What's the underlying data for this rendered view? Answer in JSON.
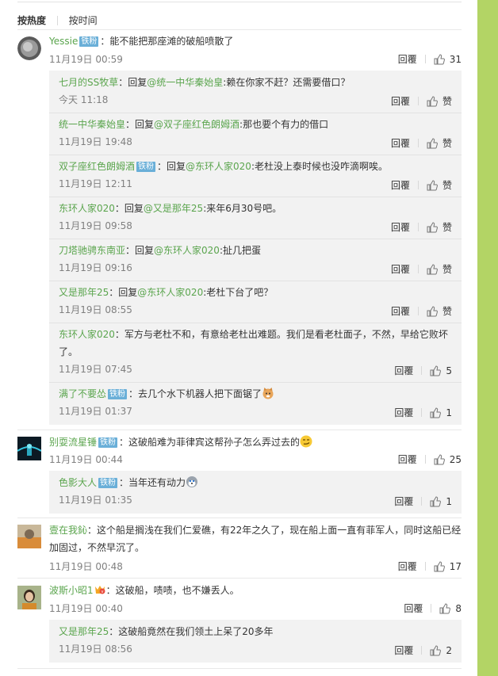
{
  "sort": {
    "hot": "按热度",
    "time": "按时间"
  },
  "reply_label": "回覆",
  "like_icon": "thumb-up-icon",
  "colors": {
    "name_link": "#5ba54e",
    "badge": "#6aafd8",
    "reply_bg": "#f2f2f2",
    "side_strip": "#b3d465"
  },
  "comments": [
    {
      "name": "Yessie",
      "badge": "铁粉",
      "text": "：能不能把那座滩的破船喷散了",
      "time": "11月19日 00:59",
      "likes": "31",
      "replies": [
        {
          "name": "七月的SS牧草",
          "pre": "：回复",
          "mention": "@统一中华秦始皇",
          "text": ":赖在你家不赶？还需要借口？",
          "time": "今天 11:18",
          "likes": "赞"
        },
        {
          "name": "统一中华秦始皇",
          "pre": "：回复",
          "mention": "@双子座红色朗姆酒",
          "text": ":那也要个有力的借口",
          "time": "11月19日 19:48",
          "likes": "赞"
        },
        {
          "name": "双子座红色朗姆酒",
          "badge": "铁粉",
          "pre": "：回复",
          "mention": "@东环人家020",
          "text": ":老杜没上泰时候也没咋滴啊唉。",
          "time": "11月19日 12:11",
          "likes": "赞"
        },
        {
          "name": "东环人家020",
          "pre": "：回复",
          "mention": "@又是那年25",
          "text": ":来年6月30号吧。",
          "time": "11月19日 09:58",
          "likes": "赞"
        },
        {
          "name": "刀塔驰骋东南亚",
          "pre": "：回复",
          "mention": "@东环人家020",
          "text": ":扯几把蛋",
          "time": "11月19日 09:16",
          "likes": "赞"
        },
        {
          "name": "又是那年25",
          "pre": "：回复",
          "mention": "@东环人家020",
          "text": ":老杜下台了吧？",
          "time": "11月19日 08:55",
          "likes": "赞"
        },
        {
          "name": "东环人家020",
          "pre": "",
          "mention": "",
          "text": "：军方与老杜不和，有意给老杜出难题。我们是看老杜面子，不然，早给它败坏了。",
          "time": "11月19日 07:45",
          "likes": "5"
        },
        {
          "name": "满了不要怂",
          "badge": "铁粉",
          "pre": "",
          "mention": "",
          "text": "：去几个水下机器人把下面锯了",
          "emoji": "cat-emoji",
          "time": "11月19日 01:37",
          "likes": "1"
        }
      ]
    },
    {
      "name": "别耍流星锤",
      "badge": "铁粉",
      "text": "：这破船难为菲律宾这帮孙子怎么弄过去的",
      "emoji": "smirk-emoji",
      "time": "11月19日 00:44",
      "likes": "25",
      "replies": [
        {
          "name": "色影大人",
          "badge": "铁粉",
          "pre": "",
          "mention": "",
          "text": "：当年还有动力",
          "emoji": "husky-emoji",
          "time": "11月19日 01:35",
          "likes": "1"
        }
      ]
    },
    {
      "name": "壹在我鈊",
      "text": "：这个船是搁浅在我们仁爱礁，有22年之久了，现在船上面一直有菲军人，同时这船已经加固过，不然早沉了。",
      "time": "11月19日 00:48",
      "likes": "17",
      "replies": []
    },
    {
      "name": "波斯小昭1",
      "vip": "VIP-badge-icon",
      "text": "：这破船，啧啧，也不嫌丢人。",
      "time": "11月19日 00:40",
      "likes": "8",
      "replies": [
        {
          "name": "又是那年25",
          "pre": "",
          "mention": "",
          "text": "：这破船竟然在我们领土上呆了20多年",
          "time": "11月19日 08:56",
          "likes": "2"
        }
      ]
    }
  ]
}
